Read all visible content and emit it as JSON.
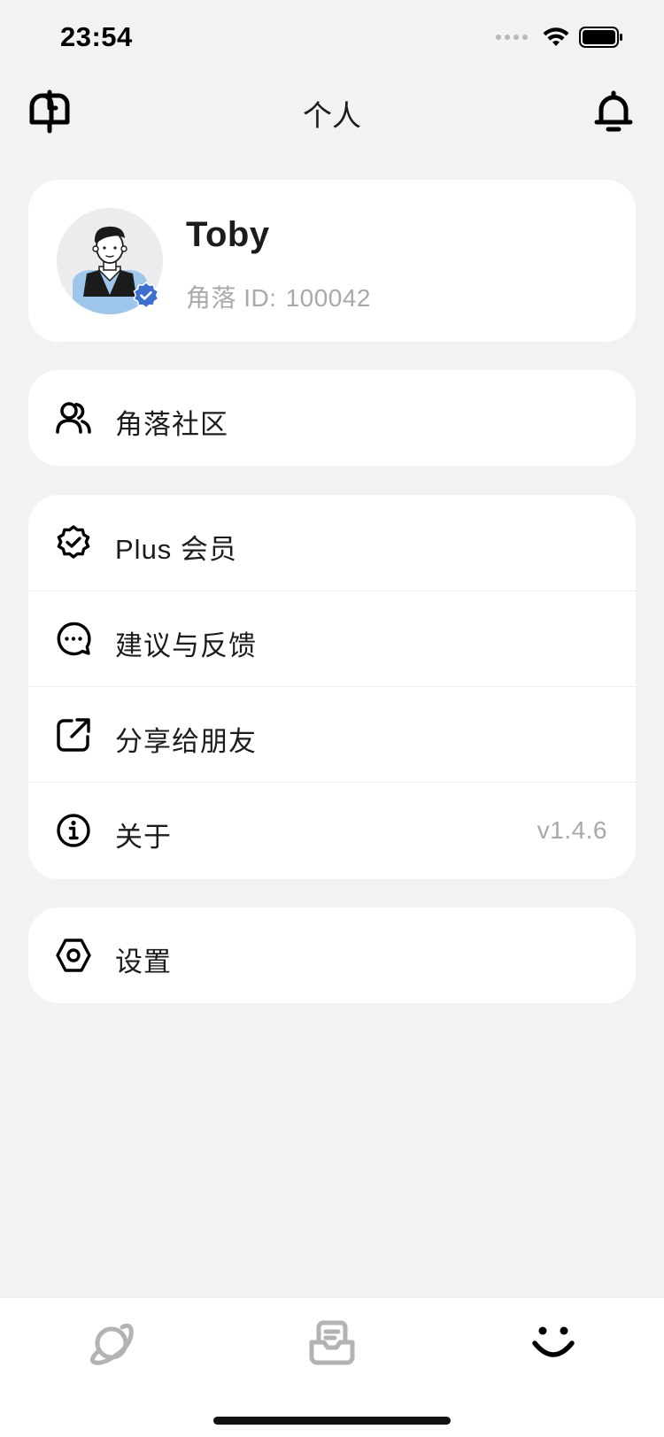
{
  "status_bar": {
    "time": "23:54",
    "icons": [
      "signal-dots-icon",
      "wifi-icon",
      "battery-icon"
    ]
  },
  "nav": {
    "title": "个人",
    "left_icon": "mailbox-icon",
    "right_icon": "bell-icon"
  },
  "profile": {
    "name": "Toby",
    "id_label": "角落 ID:",
    "id_value": "100042",
    "avatar_icon": "avatar-illustration",
    "badge_icon": "verified-badge-icon",
    "badge_color": "#3d6fd1"
  },
  "community": {
    "icon": "people-icon",
    "label": "角落社区"
  },
  "menu": {
    "items": [
      {
        "icon": "badge-check-icon",
        "label": "Plus 会员",
        "value": ""
      },
      {
        "icon": "chat-bubble-icon",
        "label": "建议与反馈",
        "value": ""
      },
      {
        "icon": "share-icon",
        "label": "分享给朋友",
        "value": ""
      },
      {
        "icon": "info-icon",
        "label": "关于",
        "value": "v1.4.6"
      }
    ]
  },
  "settings": {
    "icon": "hexagon-settings-icon",
    "label": "设置"
  },
  "tab_bar": {
    "tabs": [
      {
        "icon": "planet-icon",
        "active": false
      },
      {
        "icon": "inbox-icon",
        "active": false
      },
      {
        "icon": "smile-icon",
        "active": true
      }
    ],
    "active_color": "#000000",
    "inactive_color": "#b3b3b3"
  }
}
